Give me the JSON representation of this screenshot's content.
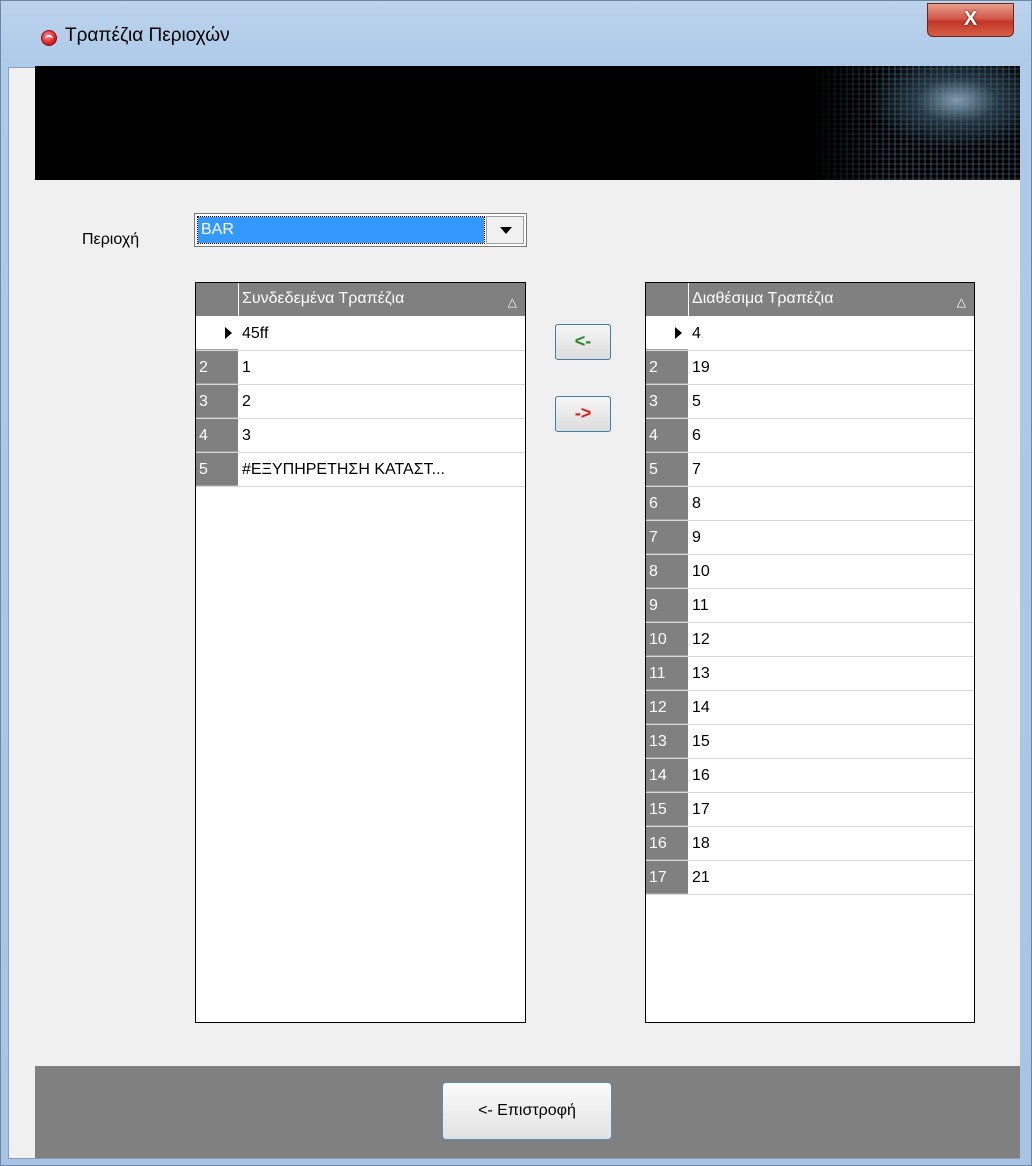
{
  "window": {
    "title": "Τραπέζια Περιοχών",
    "close_label": "X"
  },
  "area": {
    "label": "Περιοχή",
    "selected": "BAR"
  },
  "linked_grid": {
    "column": "Συνδεδεμένα Τραπέζια",
    "sort_icon": "△",
    "rows": [
      {
        "num": "",
        "value": "45ff",
        "current": true
      },
      {
        "num": "2",
        "value": "1"
      },
      {
        "num": "3",
        "value": "2"
      },
      {
        "num": "4",
        "value": "3"
      },
      {
        "num": "5",
        "value": "#ΕΞΥΠΗΡΕΤΗΣΗ ΚΑΤΑΣΤ..."
      }
    ]
  },
  "available_grid": {
    "column": "Διαθέσιμα Τραπέζια",
    "sort_icon": "△",
    "rows": [
      {
        "num": "",
        "value": "4",
        "current": true
      },
      {
        "num": "2",
        "value": "19"
      },
      {
        "num": "3",
        "value": "5"
      },
      {
        "num": "4",
        "value": "6"
      },
      {
        "num": "5",
        "value": "7"
      },
      {
        "num": "6",
        "value": "8"
      },
      {
        "num": "7",
        "value": "9"
      },
      {
        "num": "8",
        "value": "10"
      },
      {
        "num": "9",
        "value": "11"
      },
      {
        "num": "10",
        "value": "12"
      },
      {
        "num": "11",
        "value": "13"
      },
      {
        "num": "12",
        "value": "14"
      },
      {
        "num": "13",
        "value": "15"
      },
      {
        "num": "14",
        "value": "16"
      },
      {
        "num": "15",
        "value": "17"
      },
      {
        "num": "16",
        "value": "18"
      },
      {
        "num": "17",
        "value": "21"
      }
    ]
  },
  "buttons": {
    "move_left": "<-",
    "move_right": "->",
    "return": "<- Επιστροφή"
  },
  "colors": {
    "selection": "#3399ff",
    "grid_header": "#808080",
    "move_left_arrow": "#2a8a2a",
    "move_right_arrow": "#e02020"
  }
}
